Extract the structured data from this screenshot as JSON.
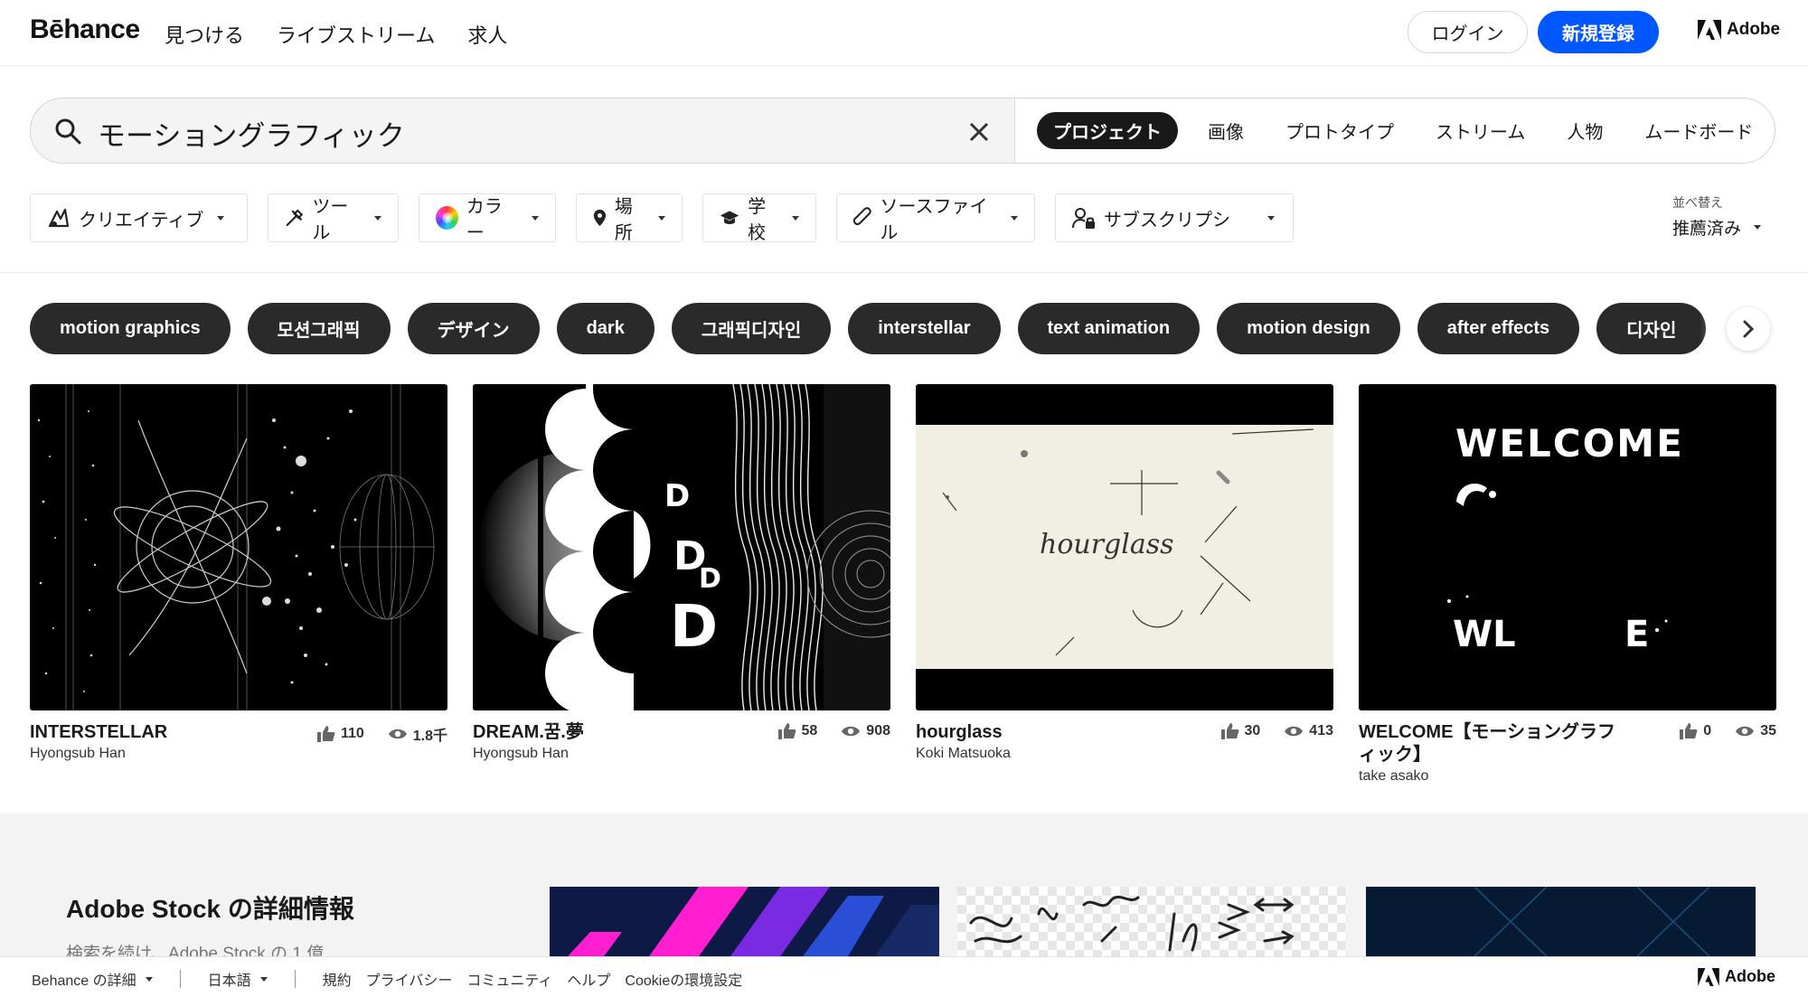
{
  "header": {
    "logo": "Bēhance",
    "nav": [
      "見つける",
      "ライブストリーム",
      "求人"
    ],
    "login_label": "ログイン",
    "signup_label": "新規登録",
    "adobe_label": "Adobe"
  },
  "search": {
    "query": "モーショングラフィック",
    "tabs": [
      "プロジェクト",
      "画像",
      "プロトタイプ",
      "ストリーム",
      "人物",
      "ムードボード"
    ],
    "active_tab": "プロジェクト"
  },
  "filters": {
    "items": [
      "クリエイティブ",
      "ツール",
      "カラー",
      "場所",
      "学校",
      "ソースファイル",
      "サブスクリプシ"
    ],
    "sort_label": "並べ替え",
    "sort_value": "推薦済み"
  },
  "tags": [
    "motion graphics",
    "모션그래픽",
    "デザイン",
    "dark",
    "그래픽디자인",
    "interstellar",
    "text animation",
    "motion design",
    "after effects",
    "디자인"
  ],
  "projects": [
    {
      "title": "INTERSTELLAR",
      "owner": "Hyongsub Han",
      "likes": "110",
      "views": "1.8千"
    },
    {
      "title": "DREAM.꿈.夢",
      "owner": "Hyongsub Han",
      "likes": "58",
      "views": "908"
    },
    {
      "title": "hourglass",
      "owner": "Koki Matsuoka",
      "likes": "30",
      "views": "413"
    },
    {
      "title": "WELCOME【モーショングラフィック】",
      "owner": "take asako",
      "likes": "0",
      "views": "35"
    }
  ],
  "thumb_text": {
    "hourglass": "hourglass",
    "welcome_top": "WELCOME",
    "welcome_bottom_left": "WL",
    "welcome_bottom_right": "E"
  },
  "stock": {
    "title": "Adobe Stock の詳細情報",
    "subtitle": "検索を続け、Adobe Stock の 1 億"
  },
  "footer": {
    "more": "Behance の詳細",
    "language": "日本語",
    "links": [
      "規約",
      "プライバシー",
      "コミュニティ",
      "ヘルプ",
      "Cookieの環境設定"
    ],
    "adobe_label": "Adobe"
  },
  "colors": {
    "accent": "#0057ff",
    "tag_bg": "#2a2a2a",
    "stock_bg": "#f3f3f3"
  }
}
